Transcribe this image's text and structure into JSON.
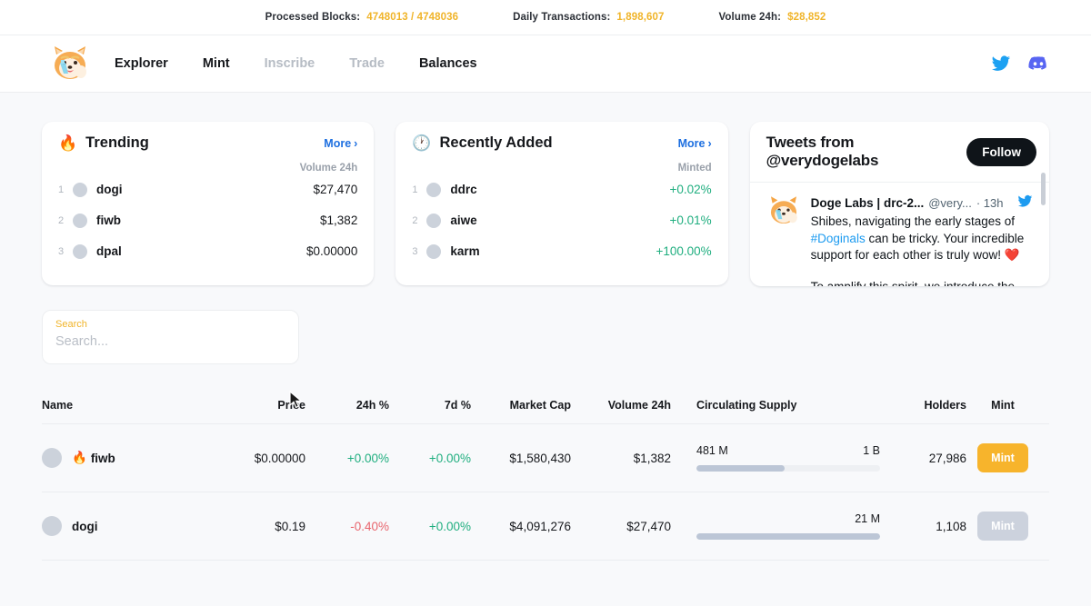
{
  "ticker": {
    "items": [
      {
        "label": "Processed Blocks:",
        "value": "4748013 / 4748036"
      },
      {
        "label": "Daily Transactions:",
        "value": "1,898,607"
      },
      {
        "label": "Volume 24h:",
        "value": "$28,852"
      }
    ],
    "accent_color": "#f0b429"
  },
  "nav": {
    "logo_icon": "shiba-flask-logo",
    "links": [
      {
        "label": "Explorer",
        "active": true
      },
      {
        "label": "Mint",
        "active": true
      },
      {
        "label": "Inscribe",
        "active": false
      },
      {
        "label": "Trade",
        "active": false
      },
      {
        "label": "Balances",
        "active": true
      }
    ],
    "socials": [
      {
        "icon": "twitter-icon",
        "color": "#1da1f2"
      },
      {
        "icon": "discord-icon",
        "color": "#5865f2"
      }
    ]
  },
  "trending": {
    "icon": "fire-icon",
    "title": "Trending",
    "more_label": "More",
    "column_label": "Volume 24h",
    "rows": [
      {
        "rank": "1",
        "name": "dogi",
        "value": "$27,470"
      },
      {
        "rank": "2",
        "name": "fiwb",
        "value": "$1,382"
      },
      {
        "rank": "3",
        "name": "dpal",
        "value": "$0.00000"
      }
    ]
  },
  "recently_added": {
    "icon": "clock-icon",
    "title": "Recently Added",
    "more_label": "More",
    "column_label": "Minted",
    "rows": [
      {
        "rank": "1",
        "name": "ddrc",
        "value": "+0.02%"
      },
      {
        "rank": "2",
        "name": "aiwe",
        "value": "+0.01%"
      },
      {
        "rank": "3",
        "name": "karm",
        "value": "+100.00%"
      }
    ]
  },
  "tweets": {
    "title": "Tweets from @verydogelabs",
    "follow_label": "Follow",
    "avatar_icon": "shiba-flask-avatar",
    "author": "Doge Labs | drc-2...",
    "handle": "@very...",
    "time": "· 13h",
    "bird_icon": "twitter-icon",
    "text_part1": "Shibes, navigating the early stages of ",
    "hashtag": "#Doginals",
    "text_part2": " can be tricky. Your incredible support for each other is truly wow! ❤️",
    "text_second": "To amplify this spirit, we introduce the"
  },
  "search": {
    "label": "Search",
    "placeholder": "Search...",
    "value": ""
  },
  "table": {
    "columns": [
      "Name",
      "Price",
      "24h %",
      "7d %",
      "Market Cap",
      "Volume 24h",
      "Circulating Supply",
      "Holders",
      "Mint"
    ],
    "rows": [
      {
        "name": "fiwb",
        "hot": "🔥",
        "price": "$0.00000",
        "change_24h": "+0.00%",
        "change_24h_dir": "pos",
        "change_7d": "+0.00%",
        "change_7d_dir": "pos",
        "market_cap": "$1,580,430",
        "volume_24h": "$1,382",
        "supply_current": "481 M",
        "supply_max": "1 B",
        "supply_percent": 48,
        "holders": "27,986",
        "mint_label": "Mint",
        "mint_enabled": true
      },
      {
        "name": "dogi",
        "hot": "",
        "price": "$0.19",
        "change_24h": "-0.40%",
        "change_24h_dir": "neg",
        "change_7d": "+0.00%",
        "change_7d_dir": "pos",
        "market_cap": "$4,091,276",
        "volume_24h": "$27,470",
        "supply_current": "",
        "supply_max": "21 M",
        "supply_percent": 100,
        "holders": "1,108",
        "mint_label": "Mint",
        "mint_enabled": false
      }
    ]
  },
  "colors": {
    "accent": "#f7b42c",
    "positive": "#1fae7f",
    "negative": "#e8656d",
    "link": "#1d6fe0",
    "page_bg": "#f8f9fb"
  }
}
